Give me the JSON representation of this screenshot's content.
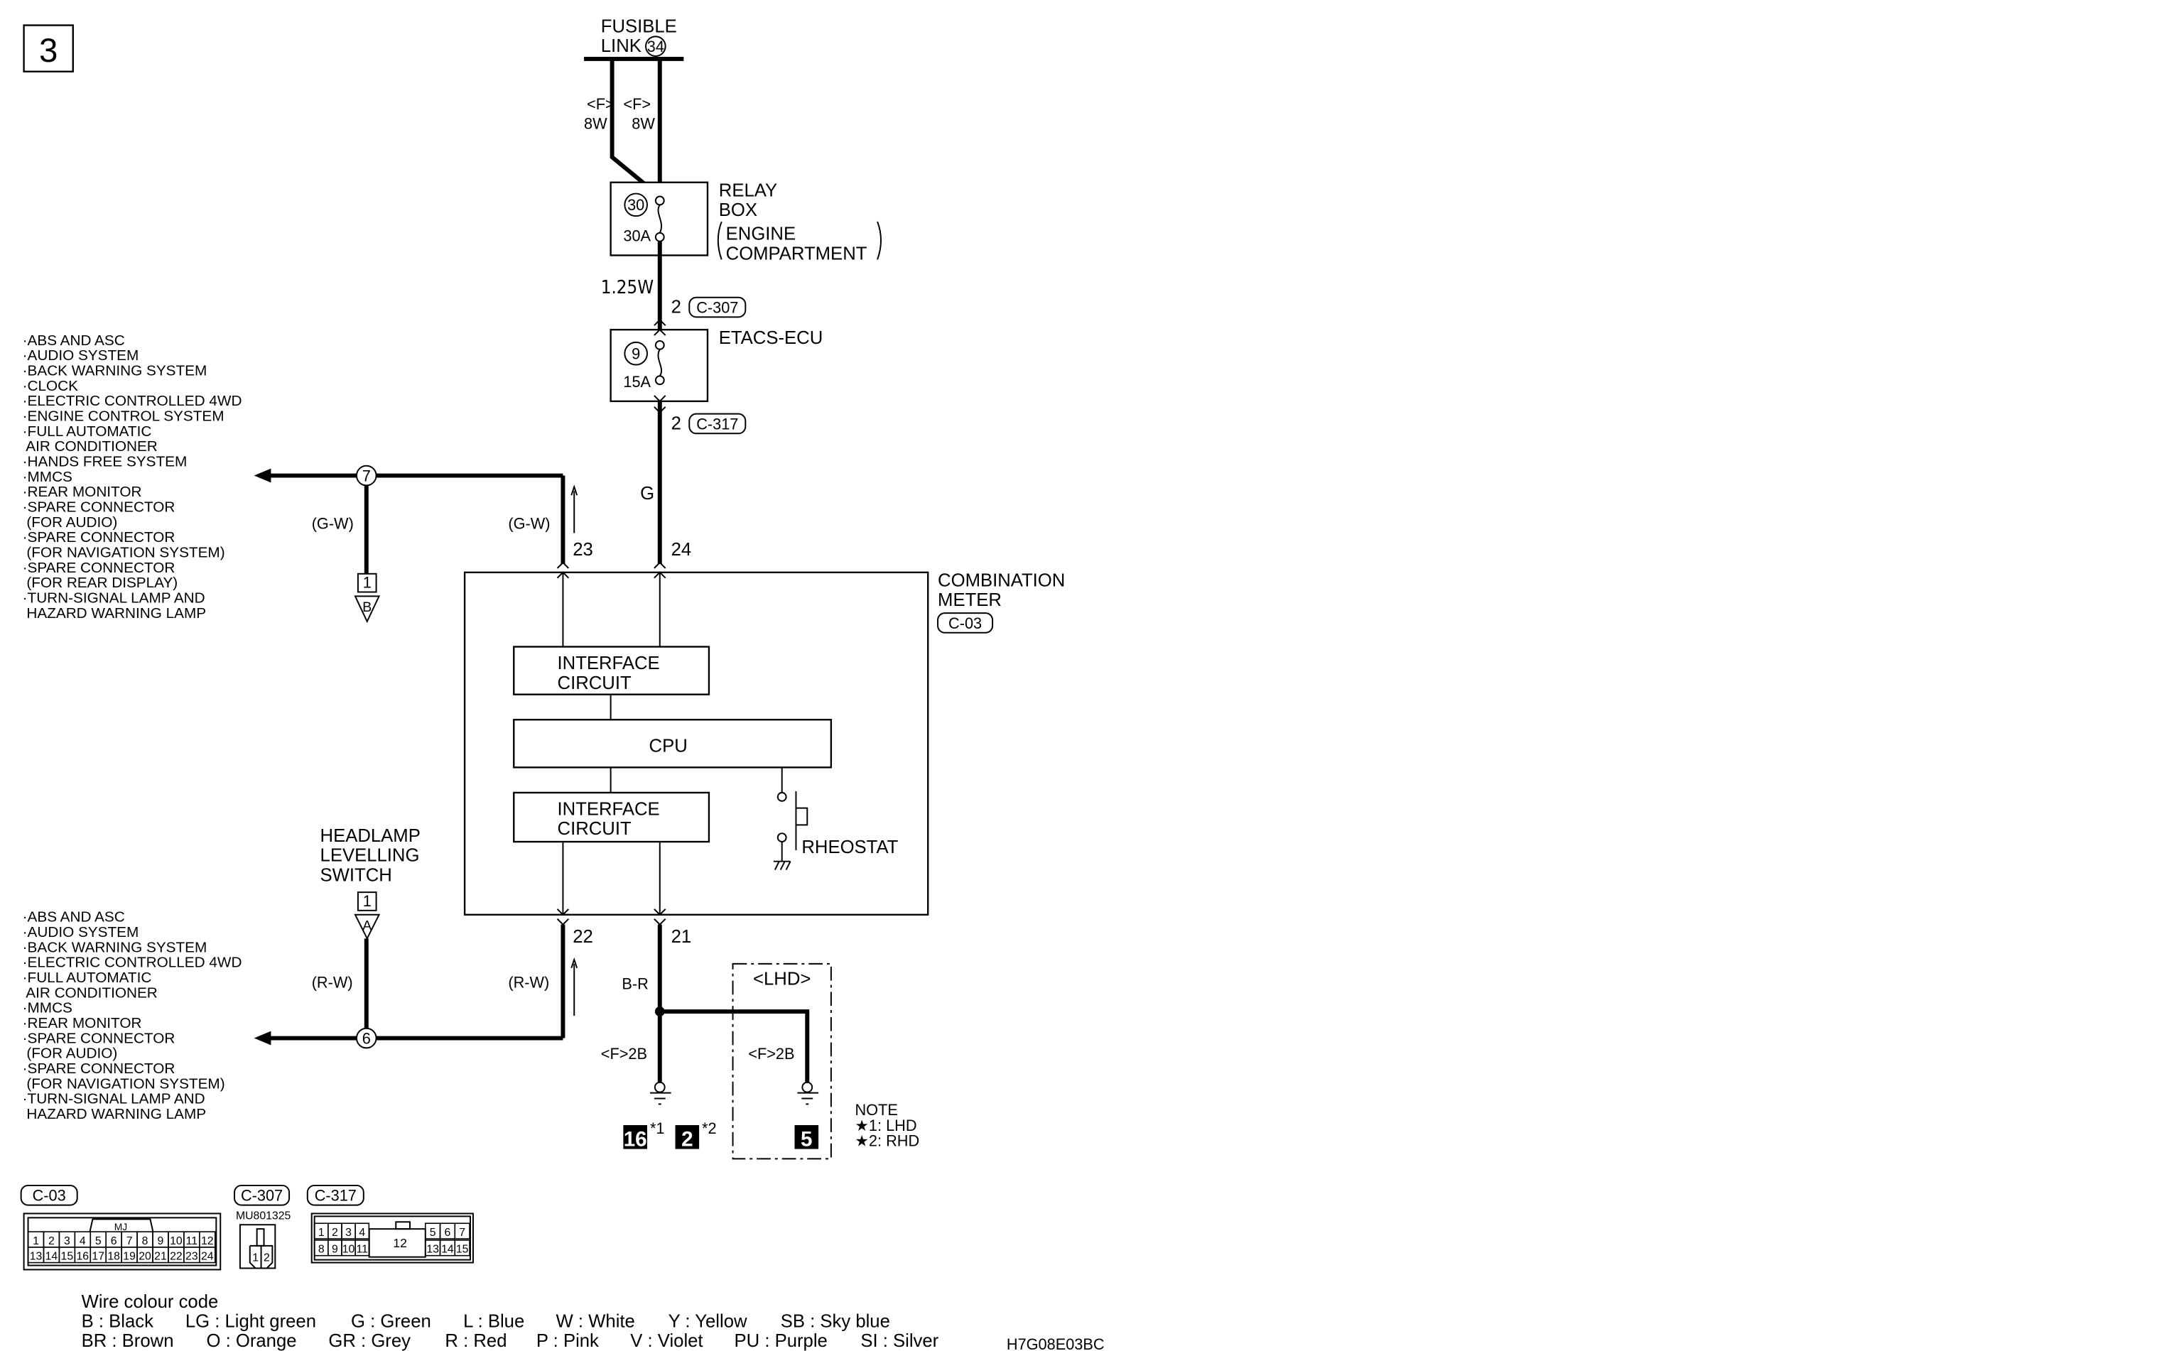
{
  "page_number": "3",
  "figure_code": "H7G08E03BC",
  "fusible_link": {
    "label_line1": "FUSIBLE",
    "label_line2": "LINK",
    "number": "34"
  },
  "feed_wires": [
    {
      "spec": "<F>",
      "size": "8W"
    },
    {
      "spec": "<F>",
      "size": "8W"
    }
  ],
  "relay_box": {
    "label_lines": [
      "RELAY",
      "BOX"
    ],
    "sub_lines": [
      "ENGINE",
      "COMPARTMENT"
    ],
    "fuse_number": "30",
    "fuse_rating": "30A"
  },
  "wire_after_relay": "1.25W",
  "c307_pin": "2",
  "c307_label": "C-307",
  "etacs": {
    "label": "ETACS-ECU",
    "fuse_number": "9",
    "fuse_rating": "15A"
  },
  "c317_pin": "2",
  "c317_label": "C-317",
  "wire_g": "G",
  "combination_meter": {
    "label_lines": [
      "COMBINATION",
      "METER"
    ],
    "connector": "C-03",
    "interface_top": [
      "INTERFACE",
      "CIRCUIT"
    ],
    "cpu": "CPU",
    "interface_bottom": [
      "INTERFACE",
      "CIRCUIT"
    ],
    "rheostat": "RHEOSTAT",
    "pins": {
      "p23": "23",
      "p24": "24",
      "p22": "22",
      "p21": "21"
    }
  },
  "upper_branch": {
    "junction": "7",
    "wire_left": "(G-W)",
    "wire_right": "(G-W)",
    "joint_pin": "1",
    "joint_letter": "B",
    "destinations": [
      "·ABS AND ASC",
      "·AUDIO SYSTEM",
      "·BACK WARNING SYSTEM",
      "·CLOCK",
      "·ELECTRIC CONTROLLED 4WD",
      "·ENGINE CONTROL SYSTEM",
      "·FULL AUTOMATIC",
      " AIR CONDITIONER",
      "·HANDS FREE SYSTEM",
      "·MMCS",
      "·REAR MONITOR",
      "·SPARE CONNECTOR",
      " (FOR AUDIO)",
      "·SPARE CONNECTOR",
      " (FOR NAVIGATION SYSTEM)",
      "·SPARE CONNECTOR",
      " (FOR REAR DISPLAY)",
      "·TURN-SIGNAL LAMP AND",
      " HAZARD WARNING LAMP"
    ]
  },
  "lower_branch": {
    "switch_label": [
      "HEADLAMP",
      "LEVELLING",
      "SWITCH"
    ],
    "junction": "6",
    "wire_left": "(R-W)",
    "wire_right": "(R-W)",
    "joint_pin": "1",
    "joint_letter": "A",
    "destinations": [
      "·ABS AND ASC",
      "·AUDIO SYSTEM",
      "·BACK WARNING SYSTEM",
      "·ELECTRIC CONTROLLED 4WD",
      "·FULL AUTOMATIC",
      " AIR CONDITIONER",
      "·MMCS",
      "·REAR MONITOR",
      "·SPARE CONNECTOR",
      " (FOR AUDIO)",
      "·SPARE CONNECTOR",
      " (FOR NAVIGATION SYSTEM)",
      "·TURN-SIGNAL LAMP AND",
      " HAZARD WARNING LAMP"
    ]
  },
  "ground": {
    "wire_br": "B-R",
    "wire_left": "<F>2B",
    "wire_right": "<F>2B",
    "lhd_label": "<LHD>",
    "ground_a": "16",
    "ground_a_note": "*1",
    "ground_b": "2",
    "ground_b_note": "*2",
    "ground_c": "5"
  },
  "note": {
    "title": "NOTE",
    "lines": [
      "★1: LHD",
      "★2: RHD"
    ]
  },
  "connectors": {
    "c03": {
      "label": "C-03",
      "key": "MJ",
      "row1": [
        "1",
        "2",
        "3",
        "4",
        "5",
        "6",
        "7",
        "8",
        "9",
        "10",
        "11",
        "12"
      ],
      "row2": [
        "13",
        "14",
        "15",
        "16",
        "17",
        "18",
        "19",
        "20",
        "21",
        "22",
        "23",
        "24"
      ]
    },
    "c307": {
      "label": "C-307",
      "part": "MU801325",
      "pins": [
        "1",
        "2"
      ]
    },
    "c317": {
      "label": "C-317",
      "row1_left": [
        "1",
        "2",
        "3",
        "4"
      ],
      "row1_right": [
        "5",
        "6",
        "7"
      ],
      "row2_left": [
        "8",
        "9",
        "10",
        "11"
      ],
      "row2_right": [
        "13",
        "14",
        "15"
      ],
      "center": "12"
    }
  },
  "wire_colour_code": {
    "title": "Wire colour code",
    "row1": [
      "B : Black",
      "LG : Light green",
      "G : Green",
      "L : Blue",
      "W : White",
      "Y : Yellow",
      "SB : Sky blue"
    ],
    "row2": [
      "BR : Brown",
      "O : Orange",
      "GR : Grey",
      "R : Red",
      "P : Pink",
      "V : Violet",
      "PU : Purple",
      "SI : Silver"
    ]
  }
}
